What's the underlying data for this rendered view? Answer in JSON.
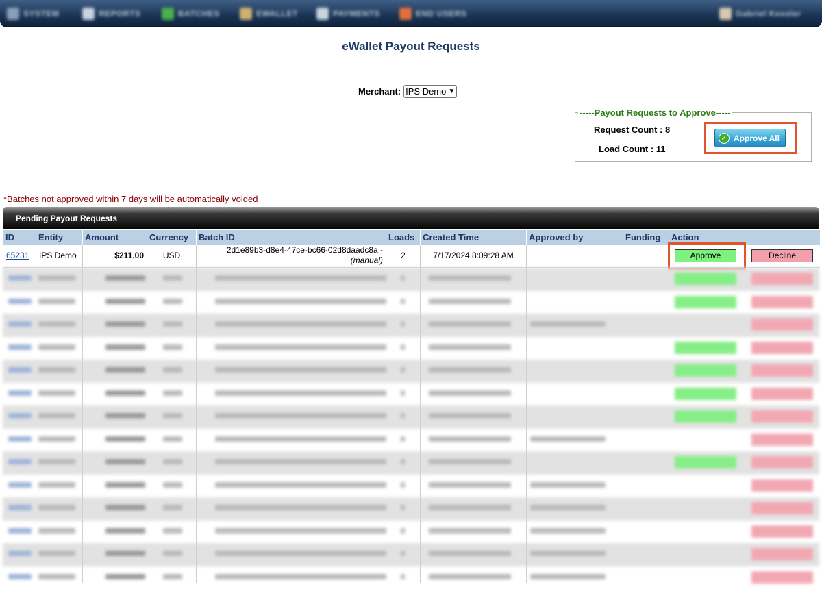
{
  "nav": {
    "items": [
      {
        "label": "SYSTEM",
        "icon": "system-icon",
        "color": "#8aa0b8"
      },
      {
        "label": "REPORTS",
        "icon": "reports-icon",
        "color": "#c8d4e0"
      },
      {
        "label": "BATCHES",
        "icon": "batches-icon",
        "color": "#4caf50"
      },
      {
        "label": "EWALLET",
        "icon": "ewallet-icon",
        "color": "#d0b070"
      },
      {
        "label": "PAYMENTS",
        "icon": "payments-icon",
        "color": "#c8d4e0"
      },
      {
        "label": "END USERS",
        "icon": "end-users-icon",
        "color": "#e07040"
      }
    ],
    "user": {
      "label": "Gabriel Kessler",
      "icon": "user-avatar-icon"
    }
  },
  "page": {
    "title": "eWallet Payout Requests"
  },
  "merchant": {
    "label": "Merchant:",
    "selected": "IPS Demo"
  },
  "approve_panel": {
    "legend": "-----Payout Requests to Approve-----",
    "request_count": "Request Count : 8",
    "load_count": "Load Count : 11",
    "approve_all_label": "Approve All"
  },
  "warning": "*Batches not approved within 7 days will be automatically voided",
  "table": {
    "title": "Pending Payout Requests",
    "columns": [
      "ID",
      "Entity",
      "Amount",
      "Currency",
      "Batch ID",
      "Loads",
      "Created Time",
      "Approved by",
      "Funding",
      "Action"
    ],
    "first_row": {
      "id": "65231",
      "entity": "IPS Demo",
      "amount": "$211.00",
      "currency": "USD",
      "batch_id": "2d1e89b3-d8e4-47ce-bc66-02d8daadc8a -",
      "batch_note": "(manual)",
      "loads": "2",
      "created": "7/17/2024 8:09:28 AM",
      "approved_by": "",
      "funding": "",
      "approve_label": "Approve",
      "decline_label": "Decline"
    },
    "blurred_rows": [
      {
        "alt": true,
        "approve": true,
        "decline": true,
        "approved_by": false
      },
      {
        "alt": false,
        "approve": true,
        "decline": true,
        "approved_by": false
      },
      {
        "alt": true,
        "approve": false,
        "decline": true,
        "approved_by": true
      },
      {
        "alt": false,
        "approve": true,
        "decline": true,
        "approved_by": false
      },
      {
        "alt": true,
        "approve": true,
        "decline": true,
        "approved_by": false
      },
      {
        "alt": false,
        "approve": true,
        "decline": true,
        "approved_by": false
      },
      {
        "alt": true,
        "approve": true,
        "decline": true,
        "approved_by": false
      },
      {
        "alt": false,
        "approve": false,
        "decline": true,
        "approved_by": true
      },
      {
        "alt": true,
        "approve": true,
        "decline": true,
        "approved_by": false
      },
      {
        "alt": false,
        "approve": false,
        "decline": true,
        "approved_by": true
      },
      {
        "alt": true,
        "approve": false,
        "decline": true,
        "approved_by": true
      },
      {
        "alt": false,
        "approve": false,
        "decline": true,
        "approved_by": true
      },
      {
        "alt": true,
        "approve": false,
        "decline": true,
        "approved_by": true
      },
      {
        "alt": false,
        "approve": false,
        "decline": true,
        "approved_by": true
      }
    ]
  },
  "colors": {
    "highlight": "#e0562c",
    "approve_btn": "#7ef27e",
    "decline_btn": "#f2a0ac",
    "header_bg": "#bcd0e4",
    "title": "#1f3864",
    "legend": "#2e7d1a",
    "warning": "#8b0000"
  }
}
